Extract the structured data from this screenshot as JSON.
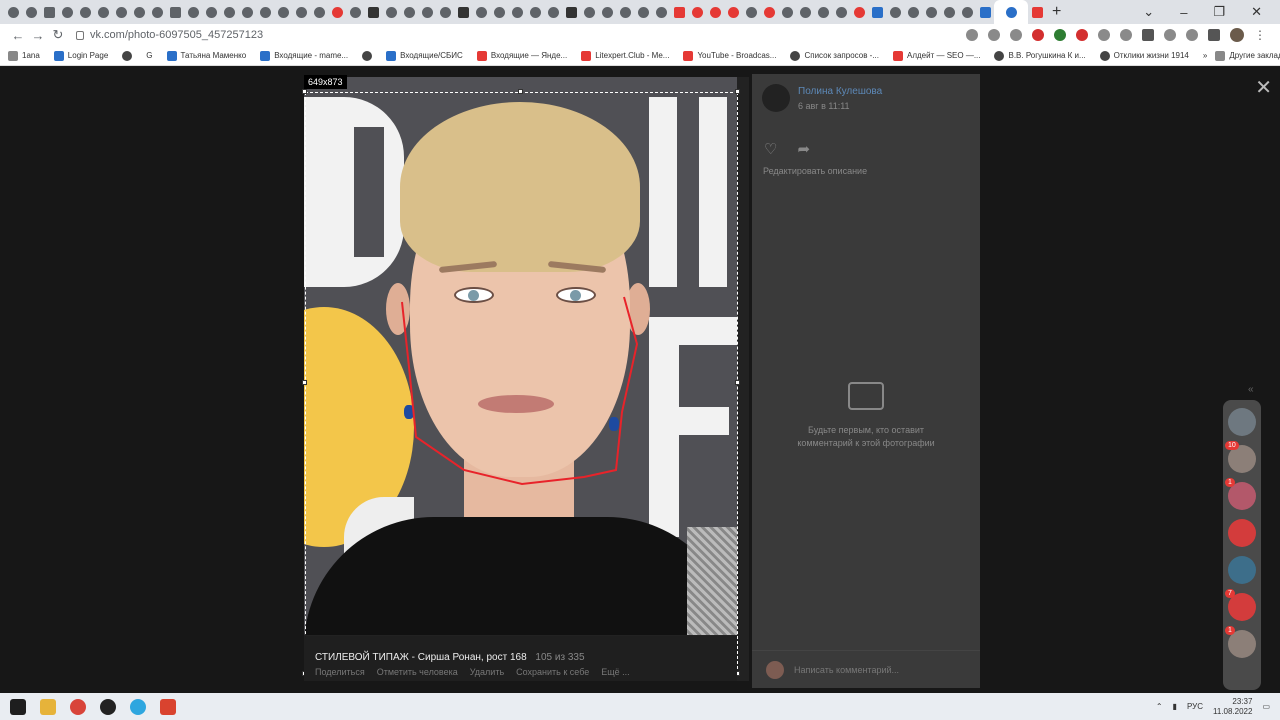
{
  "browser": {
    "url": "vk.com/photo-6097505_457257123",
    "bookmarks": [
      "1ana",
      "Login Page",
      "G",
      "Татьяна Маменко",
      "Входящие - mame...",
      "Входящие/СБИС",
      "Входящие — Янде...",
      "Litexpert.Club - Me...",
      "YouTube - Broadcas...",
      "Список запросов -...",
      "Алдейт — SEO —...",
      "В.В. Рогушкина К и...",
      "Отклики жизни 1914"
    ],
    "bookmarks_overflow": "»",
    "other_bookmarks": "Другие закладки"
  },
  "viewer": {
    "selection_size": "649x873",
    "caption_title": "СТИЛЕВОЙ ТИПАЖ - Сирша Ронан, рост 168",
    "caption_count": "105 из 335",
    "actions": [
      "Поделиться",
      "Отметить человека",
      "Удалить",
      "Сохранить к себе",
      "Ещё ..."
    ]
  },
  "panel": {
    "author": "Полина Кулешова",
    "date": "6 авг в 11:11",
    "edit_description": "Редактировать описание",
    "empty_line1": "Будьте первым, кто оставит",
    "empty_line2": "комментарий к этой фотографии",
    "comment_placeholder": "Написать комментарий..."
  },
  "dock": {
    "badges": [
      "10",
      "1",
      "",
      "",
      "7",
      "1"
    ]
  },
  "taskbar": {
    "lang": "РУС",
    "time": "23:37",
    "date": "11.08.2022"
  },
  "colors": {
    "jaw_line": "#e8232a",
    "link": "#5d89b8"
  }
}
